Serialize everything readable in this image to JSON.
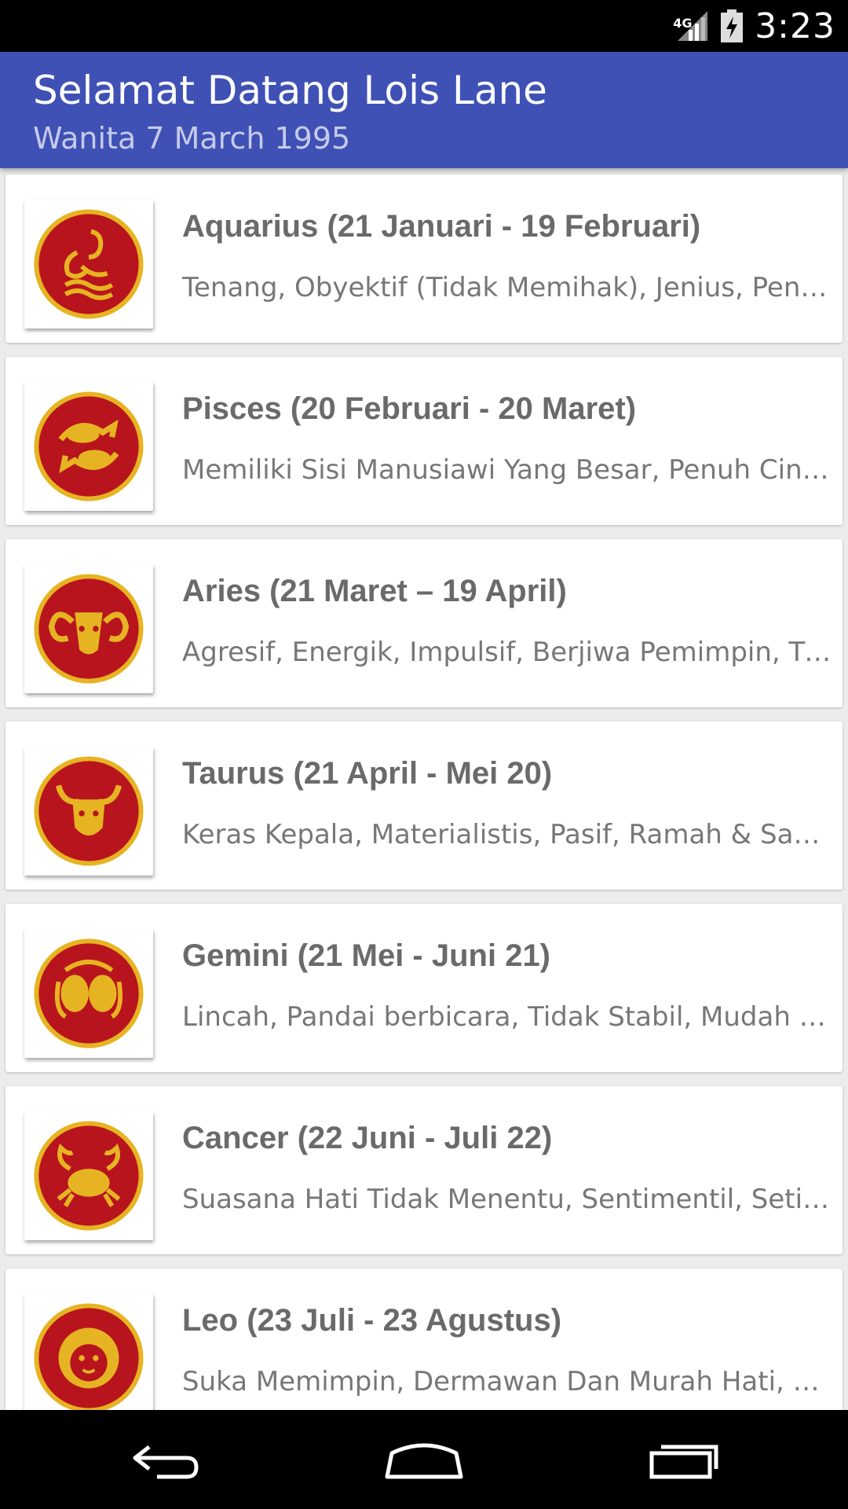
{
  "status_bar": {
    "network": "4G",
    "time": "3:23",
    "icons": [
      "signal-icon",
      "battery-charging-icon"
    ]
  },
  "app_bar": {
    "title": "Selamat Datang Lois Lane",
    "subtitle": "Wanita 7 March 1995",
    "color": "#3f51b5"
  },
  "zodiac_list": [
    {
      "icon": "aquarius-icon",
      "title": "Aquarius (21 Januari - 19 Februari)",
      "description": "Tenang, Obyektif (Tidak Memihak), Jenius, Penuh Pengertian"
    },
    {
      "icon": "pisces-icon",
      "title": "Pisces (20 Februari - 20 Maret)",
      "description": "Memiliki Sisi Manusiawi Yang Besar, Penuh Cinta Kasih"
    },
    {
      "icon": "aries-icon",
      "title": "Aries (21 Maret – 19 April)",
      "description": "Agresif, Energik, Impulsif, Berjiwa Pemimpin, Tidak Sabaran"
    },
    {
      "icon": "taurus-icon",
      "title": "Taurus (21 April - Mei 20)",
      "description": "Keras Kepala, Materialistis, Pasif, Ramah & Sabar"
    },
    {
      "icon": "gemini-icon",
      "title": "Gemini (21 Mei - Juni 21)",
      "description": "Lincah, Pandai berbicara, Tidak Stabil, Mudah Bosan"
    },
    {
      "icon": "cancer-icon",
      "title": "Cancer (22 Juni - Juli 22)",
      "description": "Suasana Hati Tidak Menentu, Sentimentil, Setia, Protektif"
    },
    {
      "icon": "leo-icon",
      "title": "Leo (23 Juli - 23 Agustus)",
      "description": "Suka Memimpin, Dermawan Dan Murah Hati, Percaya Diri"
    }
  ],
  "nav_bar": {
    "icons": [
      "back-icon",
      "home-icon",
      "recent-apps-icon"
    ]
  },
  "colors": {
    "badge_red": "#b8141e",
    "badge_gold": "#e6b422"
  }
}
